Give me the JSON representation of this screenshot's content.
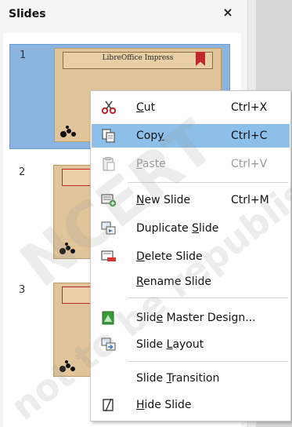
{
  "panel": {
    "title": "Slides",
    "close_glyph": "×"
  },
  "slides": [
    {
      "number": "1",
      "thumb_title": "LibreOffice Impress",
      "selected": true
    },
    {
      "number": "2",
      "thumb_title": "",
      "selected": false
    },
    {
      "number": "3",
      "thumb_title": "",
      "selected": false
    }
  ],
  "context_menu": {
    "items": [
      {
        "label": "Cut",
        "mnemonic": "C",
        "shortcut": "Ctrl+X",
        "icon": "scissors-icon",
        "enabled": true,
        "highlighted": false
      },
      {
        "label": "Copy",
        "mnemonic": "y",
        "shortcut": "Ctrl+C",
        "icon": "copy-icon",
        "enabled": true,
        "highlighted": true
      },
      {
        "label": "Paste",
        "mnemonic": "P",
        "shortcut": "Ctrl+V",
        "icon": "paste-icon",
        "enabled": false,
        "highlighted": false
      },
      {
        "label": "New Slide",
        "mnemonic": "N",
        "shortcut": "Ctrl+M",
        "icon": "new-slide-icon",
        "enabled": true,
        "highlighted": false
      },
      {
        "label": "Duplicate Slide",
        "mnemonic": "S",
        "shortcut": "",
        "icon": "duplicate-slide-icon",
        "enabled": true,
        "highlighted": false
      },
      {
        "label": "Delete Slide",
        "mnemonic": "D",
        "shortcut": "",
        "icon": "delete-slide-icon",
        "enabled": true,
        "highlighted": false
      },
      {
        "label": "Rename Slide",
        "mnemonic": "R",
        "shortcut": "",
        "icon": "",
        "enabled": true,
        "highlighted": false
      },
      {
        "label": "Slide Master Design...",
        "mnemonic": "e",
        "shortcut": "",
        "icon": "slide-master-icon",
        "enabled": true,
        "highlighted": false
      },
      {
        "label": "Slide Layout",
        "mnemonic": "L",
        "shortcut": "",
        "icon": "slide-layout-icon",
        "enabled": true,
        "highlighted": false
      },
      {
        "label": "Slide Transition",
        "mnemonic": "T",
        "shortcut": "",
        "icon": "",
        "enabled": true,
        "highlighted": false
      },
      {
        "label": "Hide Slide",
        "mnemonic": "H",
        "shortcut": "",
        "icon": "hide-slide-icon",
        "enabled": true,
        "highlighted": false
      }
    ]
  },
  "watermark": {
    "lines": [
      "NCERT",
      "not to be republished"
    ]
  },
  "colors": {
    "selection": "#8cb4e0",
    "menu_highlight": "#8cc0ea",
    "thumb_bg": "#e0c59a",
    "bookmark": "#c0272d"
  }
}
